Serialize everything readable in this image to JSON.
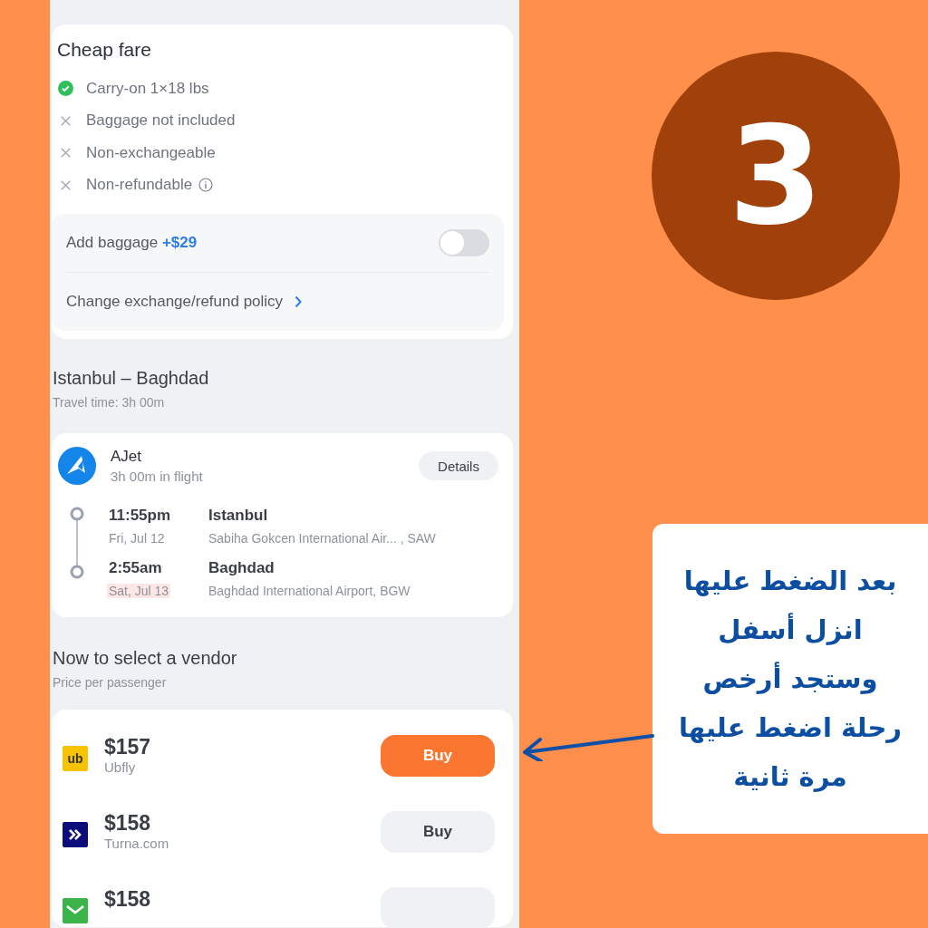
{
  "step": {
    "number": "3"
  },
  "fare": {
    "title": "Cheap fare",
    "features": [
      {
        "text": "Carry-on 1×18 lbs",
        "included": true,
        "info": false
      },
      {
        "text": "Baggage not included",
        "included": false,
        "info": false
      },
      {
        "text": "Non-exchangeable",
        "included": false,
        "info": false
      },
      {
        "text": "Non-refundable",
        "included": false,
        "info": true
      }
    ],
    "add_baggage": {
      "label": "Add baggage",
      "price": "+$29",
      "on": false
    },
    "policy_link": "Change exchange/refund policy"
  },
  "route": {
    "title": "Istanbul – Baghdad",
    "travel_time": "Travel time: 3h 00m"
  },
  "flight": {
    "airline": "AJet",
    "duration": "3h 00m in flight",
    "details_button": "Details",
    "stops": [
      {
        "time": "11:55pm",
        "date": "Fri, Jul 12",
        "date_highlighted": false,
        "city": "Istanbul",
        "airport": "Sabiha Gokcen International Air... , SAW"
      },
      {
        "time": "2:55am",
        "date": "Sat, Jul 13",
        "date_highlighted": true,
        "city": "Baghdad",
        "airport": "Baghdad International Airport, BGW"
      }
    ]
  },
  "vendors": {
    "title": "Now to select a vendor",
    "subtitle": "Price per passenger",
    "items": [
      {
        "kind": "text-logo",
        "logo_text": "ub",
        "price": "$157",
        "name": "Ubfly",
        "buy": "Buy",
        "primary": true
      },
      {
        "kind": "chevron-logo",
        "price": "$158",
        "name": "Turna.com",
        "buy": "Buy",
        "primary": false
      },
      {
        "kind": "mail-logo",
        "price": "$158",
        "primary": false
      }
    ]
  },
  "callout": {
    "text": "بعد الضغط عليها\nانزل أسفل\nوستجد أرخص\nرحلة اضغط عليها\nمرة ثانية"
  }
}
